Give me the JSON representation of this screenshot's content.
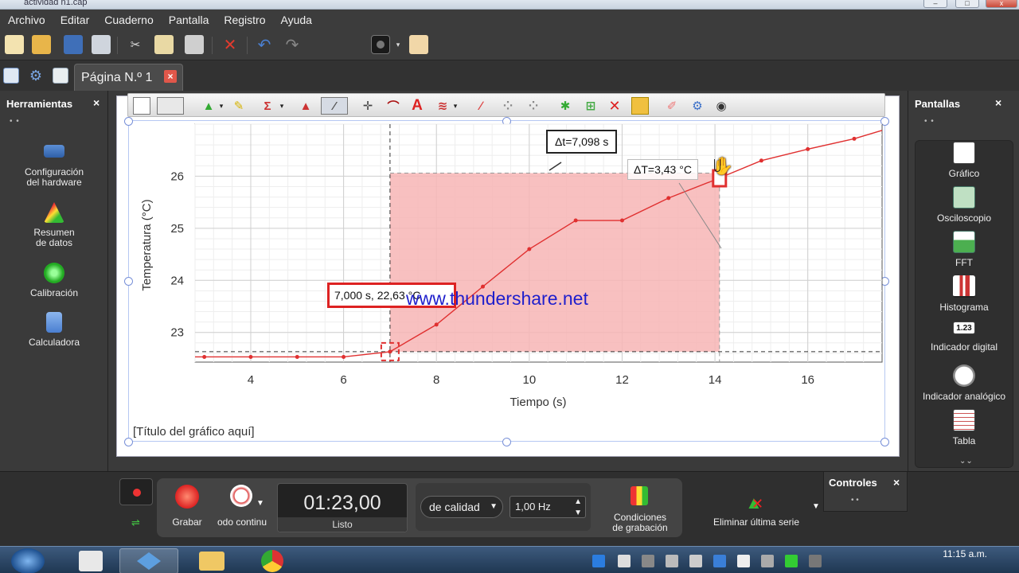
{
  "window": {
    "title": "actividad n1.cap"
  },
  "menu": [
    "Archivo",
    "Editar",
    "Cuaderno",
    "Pantalla",
    "Registro",
    "Ayuda"
  ],
  "toolbar_icons": [
    "new-icon",
    "open-icon",
    "save-icon",
    "print-icon",
    "cut-icon",
    "copy-icon",
    "paste-icon",
    "delete-icon",
    "undo-icon",
    "redo-icon",
    "camera-icon",
    "layout-icon"
  ],
  "tabs": {
    "page_label": "Página N.º 1",
    "close": "×"
  },
  "left_panel": {
    "title": "Herramientas",
    "close": "×",
    "dots": "• •",
    "items": [
      {
        "label1": "Configuración",
        "label2": "del hardware"
      },
      {
        "label1": "Resumen",
        "label2": "de datos"
      },
      {
        "label1": "Calibración",
        "label2": ""
      },
      {
        "label1": "Calculadora",
        "label2": ""
      }
    ]
  },
  "right_panel": {
    "title": "Pantallas",
    "close": "×",
    "dots": "• •",
    "items": [
      "Gráfico",
      "Osciloscopio",
      "FFT",
      "Histograma",
      "Indicador digital",
      "Indicador analógico",
      "Tabla"
    ],
    "scroll": "⌄⌄"
  },
  "chart": {
    "title_placeholder": "[Título del gráfico aquí]",
    "watermark": "www.thundershare.net",
    "annotation_point": "7,000 s, 22,63 °C",
    "annotation_dt": "Δt=7,098 s",
    "annotation_dT": "ΔT=3,43 °C"
  },
  "chart_data": {
    "type": "line",
    "xlabel": "Tiempo (s)",
    "ylabel": "Temperatura (°C)",
    "title": "",
    "xlim": [
      2.8,
      17.6
    ],
    "ylim": [
      22.43,
      27.0
    ],
    "x_ticks": [
      4,
      6,
      8,
      10,
      12,
      14,
      16
    ],
    "y_ticks": [
      23,
      24,
      25,
      26
    ],
    "grid": true,
    "legend": "none",
    "line_color": "#e03030",
    "region_color": "#f7b5b5",
    "series": [
      {
        "x": [
          3,
          4,
          5,
          6,
          7,
          8,
          9,
          10,
          11,
          12,
          13,
          14,
          15,
          16,
          17
        ],
        "y": [
          22.53,
          22.53,
          22.53,
          22.53,
          22.63,
          23.15,
          23.88,
          24.6,
          25.15,
          25.15,
          25.58,
          25.93,
          26.3,
          26.52,
          26.72
        ]
      }
    ],
    "selection": {
      "x0": 7.0,
      "x1": 14.098,
      "y0": 22.63,
      "y1": 26.06
    }
  },
  "bottom": {
    "record_label": "Grabar",
    "mode_label": "odo continu",
    "timer_value": "01:23,00",
    "timer_status": "Listo",
    "quality_label": "de calidad",
    "rate_value": "1,00 Hz",
    "conditions_label1": "Condiciones",
    "conditions_label2": "de grabación",
    "delete_series_label": "Eliminar última serie",
    "controls_title": "Controles",
    "controls_close": "×",
    "controls_dots": "• •"
  },
  "taskbar": {
    "clock": "11:15 a.m."
  }
}
